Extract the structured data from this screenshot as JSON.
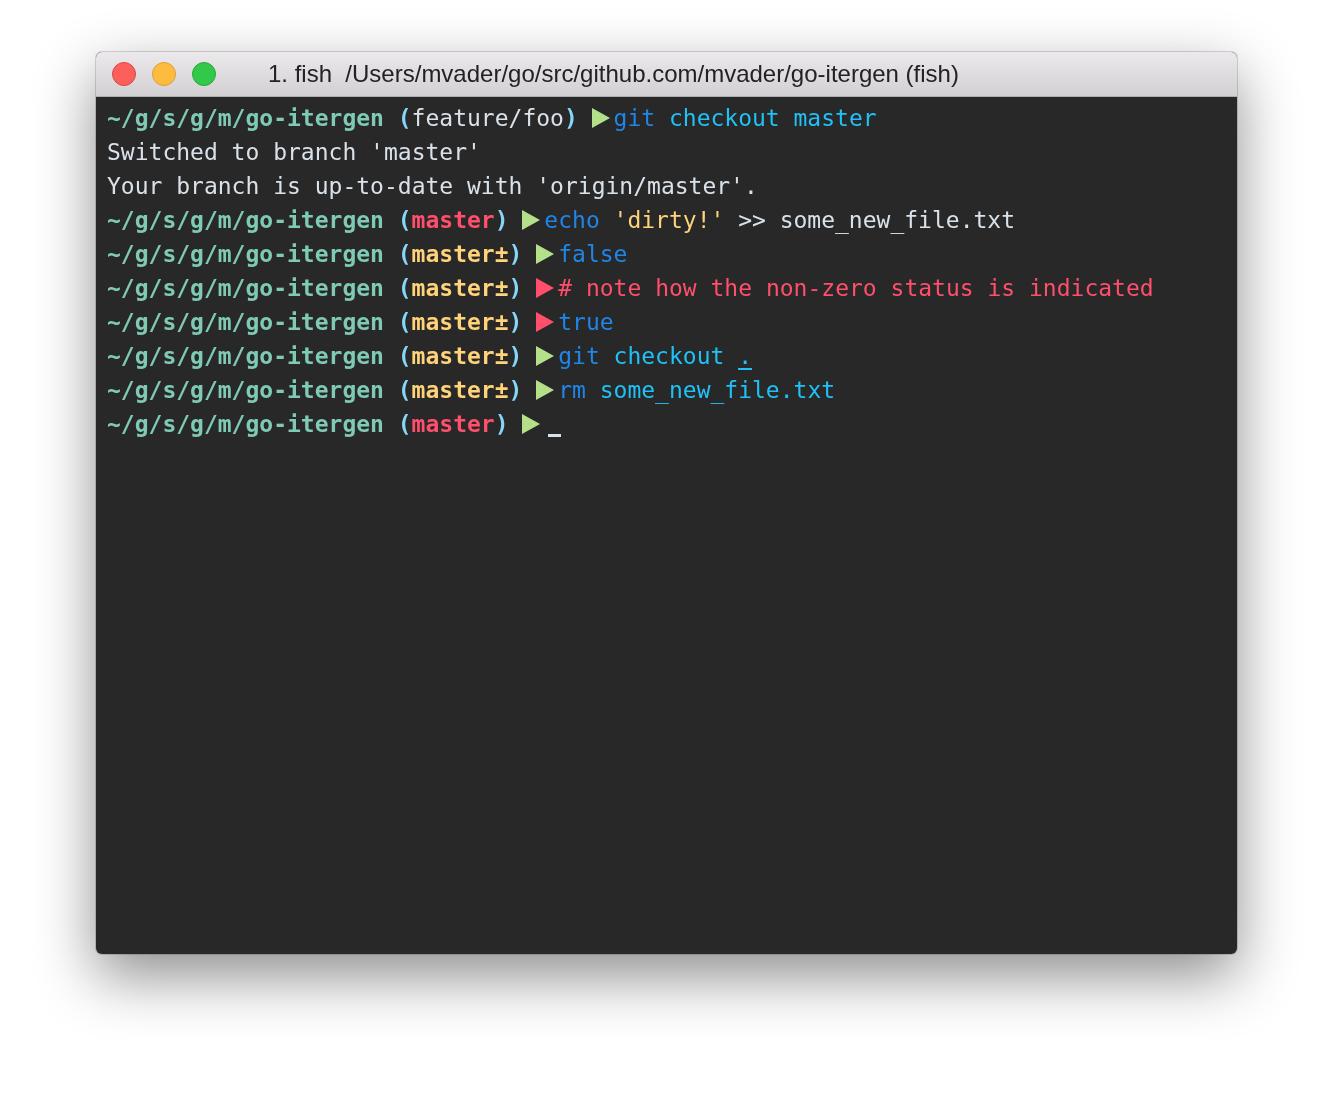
{
  "window": {
    "title": "1. fish  /Users/mvader/go/src/github.com/mvader/go-itergen (fish)"
  },
  "lines": [
    {
      "kind": "prompt",
      "path": "~/g/s/g/m/go-itergen",
      "open": "(",
      "branch": "feature/foo",
      "close": ")",
      "highlighted": false,
      "failed": false,
      "cursor": false,
      "tokens": [
        {
          "kind": "command",
          "text": "git"
        },
        {
          "kind": "argument",
          "text": "checkout"
        },
        {
          "kind": "argument",
          "text": "master"
        }
      ]
    },
    {
      "kind": "output",
      "text": "Switched to branch 'master'"
    },
    {
      "kind": "output",
      "text": "Your branch is up-to-date with 'origin/master'."
    },
    {
      "kind": "prompt",
      "path": "~/g/s/g/m/go-itergen",
      "open": "(",
      "branch": "master",
      "close": ")",
      "highlighted": true,
      "dirty": false,
      "failed": false,
      "cursor": false,
      "tokens": [
        {
          "kind": "command",
          "text": "echo"
        },
        {
          "kind": "string",
          "text": "'dirty!'"
        },
        {
          "kind": "plain",
          "text": ">>"
        },
        {
          "kind": "plain",
          "text": "some_new_file.txt"
        }
      ]
    },
    {
      "kind": "prompt",
      "path": "~/g/s/g/m/go-itergen",
      "open": "(",
      "branch": "master±",
      "close": ")",
      "highlighted": true,
      "dirty": true,
      "failed": false,
      "cursor": false,
      "tokens": [
        {
          "kind": "command",
          "text": "false"
        }
      ]
    },
    {
      "kind": "prompt",
      "path": "~/g/s/g/m/go-itergen",
      "open": "(",
      "branch": "master±",
      "close": ")",
      "highlighted": true,
      "dirty": true,
      "failed": true,
      "cursor": false,
      "tokens": [
        {
          "kind": "comment",
          "text": "# note how the non-zero status is indicated"
        }
      ]
    },
    {
      "kind": "prompt",
      "path": "~/g/s/g/m/go-itergen",
      "open": "(",
      "branch": "master±",
      "close": ")",
      "highlighted": true,
      "dirty": true,
      "failed": true,
      "cursor": false,
      "tokens": [
        {
          "kind": "command",
          "text": "true"
        }
      ]
    },
    {
      "kind": "prompt",
      "path": "~/g/s/g/m/go-itergen",
      "open": "(",
      "branch": "master±",
      "close": ")",
      "highlighted": true,
      "dirty": true,
      "failed": false,
      "cursor": false,
      "tokens": [
        {
          "kind": "command",
          "text": "git"
        },
        {
          "kind": "argument",
          "text": "checkout"
        },
        {
          "kind": "path",
          "text": "."
        }
      ]
    },
    {
      "kind": "prompt",
      "path": "~/g/s/g/m/go-itergen",
      "open": "(",
      "branch": "master±",
      "close": ")",
      "highlighted": true,
      "dirty": true,
      "failed": false,
      "cursor": false,
      "tokens": [
        {
          "kind": "command",
          "text": "rm"
        },
        {
          "kind": "argument",
          "text": "some_new_file.txt"
        }
      ]
    },
    {
      "kind": "prompt",
      "path": "~/g/s/g/m/go-itergen",
      "open": "(",
      "branch": "master",
      "close": ")",
      "highlighted": true,
      "dirty": false,
      "failed": false,
      "cursor": true
    }
  ]
}
